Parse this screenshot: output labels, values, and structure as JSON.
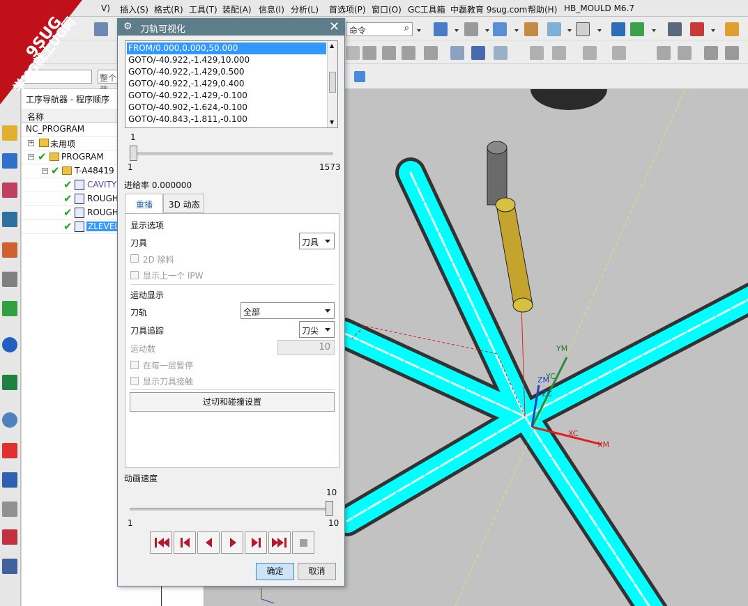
{
  "menubar": {
    "items": [
      "V)",
      "插入(S)",
      "格式(R)",
      "工具(T)",
      "装配(A)",
      "信息(I)",
      "分析(L)",
      "首选项(P)",
      "窗口(O)",
      "GC工具箱",
      "中磊教育 9sug.com",
      "帮助(H)",
      "HB_MOULD M6.7"
    ]
  },
  "watermark": {
    "line1": "9SUG",
    "line2": "学UG就上UG网"
  },
  "toolbar": {
    "command_search_placeholder": "命令",
    "filter_placeholder": "整个装"
  },
  "navigator": {
    "title": "工序导航器 - 程序顺序",
    "column_name": "名称",
    "rows": [
      {
        "label": "NC_PROGRAM"
      },
      {
        "label": "未用项"
      },
      {
        "label": "PROGRAM"
      },
      {
        "label": "T-A48419"
      },
      {
        "label": "CAVITY"
      },
      {
        "label": "ROUGH"
      },
      {
        "label": "ROUGH"
      },
      {
        "label": "ZLEVEL"
      }
    ]
  },
  "dialog": {
    "title": "刀轨可视化",
    "path_lines": [
      "FROM/0.000,0.000,50.000",
      "GOTO/-40.922,-1.429,10.000",
      "GOTO/-40.922,-1.429,0.500",
      "GOTO/-40.922,-1.429,0.400",
      "GOTO/-40.922,-1.429,-0.100",
      "GOTO/-40.902,-1.624,-0.100",
      "GOTO/-40.843,-1.811,-0.100"
    ],
    "progress": {
      "current": "1",
      "min": "1",
      "max": "1573",
      "fraction": 0.0
    },
    "feed_rate_label": "进给率 0.000000",
    "tabs": [
      "重播",
      "3D 动态"
    ],
    "display_options": {
      "header": "显示选项",
      "tool_label": "刀具",
      "tool_value": "刀具",
      "remove_2d": "2D 除料",
      "show_prev_ipw": "显示上一个 IPW"
    },
    "motion_display": {
      "header": "运动显示",
      "path_label": "刀轨",
      "path_value": "全部",
      "trace_label": "刀具追踪",
      "trace_value": "刀尖",
      "count_label": "运动数",
      "count_value": "10",
      "pause_each_layer": "在每一层暂停",
      "show_tool_contact": "显示刀具接触"
    },
    "gouge_button": "过切和碰撞设置",
    "animation": {
      "label": "动画速度",
      "value": "10",
      "min": "1",
      "max": "10",
      "fraction": 1.0
    },
    "ok": "确定",
    "cancel": "取消"
  },
  "viewport": {
    "axes": {
      "ym": "YM",
      "yc": "YC",
      "zm": "ZM",
      "zc": "ZC",
      "xc": "XC",
      "xm": "XM"
    },
    "colors": {
      "slot": "#00ffff",
      "background": "#c2c2c2",
      "holder": "#c4a42c"
    }
  }
}
